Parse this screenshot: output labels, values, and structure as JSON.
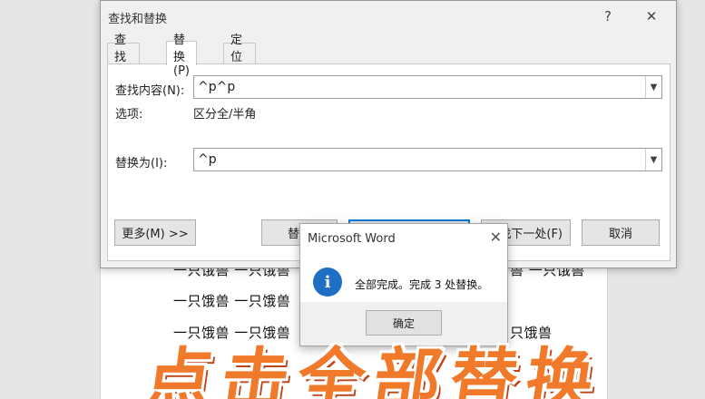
{
  "dialog": {
    "title": "查找和替换",
    "help_glyph": "?",
    "close_glyph": "✕",
    "tabs": [
      {
        "label": "查找(D)"
      },
      {
        "label": "替换(P)"
      },
      {
        "label": "定位(G)"
      }
    ],
    "find": {
      "label": "查找内容(N):",
      "value": "^p^p"
    },
    "options": {
      "label": "选项:",
      "value": "区分全/半角"
    },
    "replace": {
      "label": "替换为(I):",
      "value": "^p"
    },
    "buttons": {
      "more": "更多(M) >>",
      "replace_partial": "替换",
      "find_next_partial": "找下一处(F)",
      "cancel": "取消"
    }
  },
  "message_box": {
    "title": "Microsoft Word",
    "close_glyph": "✕",
    "icon": "info-icon",
    "text": "全部完成。完成 3 处替换。",
    "ok": "确定"
  },
  "document": {
    "lines": [
      "一只饿兽 一只饿兽",
      "兽 一只饿兽",
      "一只饿兽 一只饿兽",
      "一只饿兽 一只饿兽",
      "只饿兽"
    ]
  },
  "caption": {
    "text": "点击全部替换"
  },
  "colors": {
    "accent": "#0078d7",
    "caption": "#f07a2a",
    "info_icon": "#1f6fc5"
  }
}
